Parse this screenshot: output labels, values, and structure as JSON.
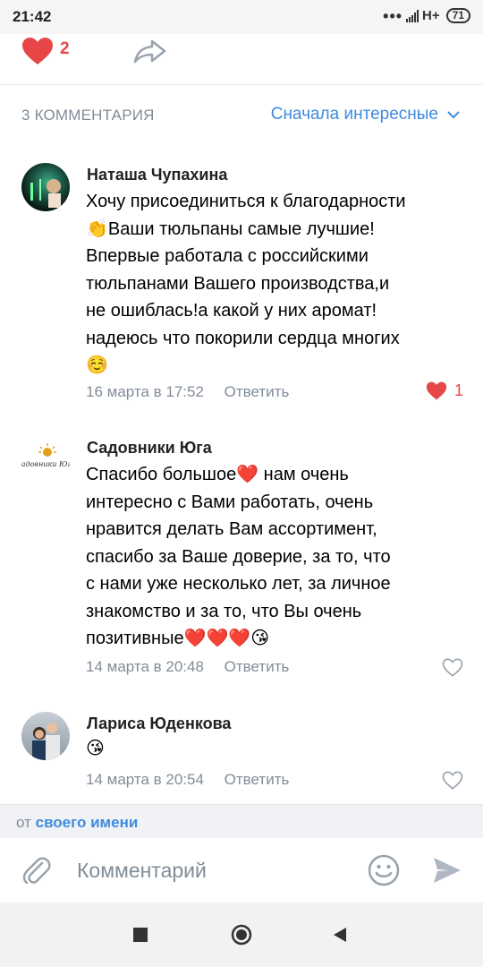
{
  "status_bar": {
    "time": "21:42",
    "network": "H+",
    "battery": "71"
  },
  "post_actions": {
    "like_count": "2"
  },
  "comments_header": {
    "count_label": "3 КОММЕНТАРИЯ",
    "sort_label": "Сначала интересные"
  },
  "comments": [
    {
      "author": "Наташа Чупахина",
      "lines": [
        "Хочу присоединиться к благодарности",
        "👏Ваши тюльпаны самые лучшие!",
        "Впервые работала с российскими",
        "тюльпанами Вашего производства,и",
        "не ошиблась!а какой у них аромат!",
        "надеюсь что покорили сердца многих",
        "☺️"
      ],
      "date": "16 марта в 17:52",
      "reply": "Ответить",
      "likes": "1"
    },
    {
      "author": "Садовники Юга",
      "avatar_text": "Садовники Юга",
      "lines": [
        "Спасибо большое❤️ нам очень",
        "интересно с Вами работать, очень",
        "нравится делать Вам ассортимент,",
        "спасибо за Ваше доверие, за то, что",
        "с нами уже несколько лет, за личное",
        "знакомство и за то, что Вы очень",
        "позитивные❤️❤️❤️😘"
      ],
      "date": "14 марта в 20:48",
      "reply": "Ответить"
    },
    {
      "author": "Лариса Юденкова",
      "lines": [
        "😘"
      ],
      "date": "14 марта в 20:54",
      "reply": "Ответить"
    }
  ],
  "author_strip": {
    "prefix": "от",
    "link": "своего имени"
  },
  "input": {
    "placeholder": "Комментарий"
  },
  "colors": {
    "accent": "#3f8ae0",
    "like": "#e64646",
    "secondary_text": "#818c99"
  },
  "icons": [
    "heart-icon",
    "share-icon",
    "chevron-down-icon",
    "heart-outline-icon",
    "paperclip-icon",
    "smile-icon",
    "send-icon",
    "nav-square-icon",
    "nav-home-icon",
    "nav-back-icon"
  ]
}
